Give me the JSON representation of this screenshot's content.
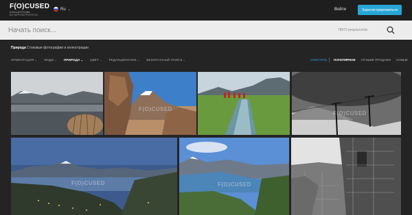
{
  "header": {
    "logo_main": "F(O)CUSED",
    "logo_sub": "COLLECTION",
    "logo_by": "BY DEPOSITPHOTOS",
    "lang": "Ru",
    "login": "Войти",
    "register": "Зарегистрироваться"
  },
  "search": {
    "placeholder": "Начать поиск...",
    "results": "76672 результатов"
  },
  "breadcrumb": {
    "category": "Природа",
    "description": "Стоковые фотографии и иллюстрации"
  },
  "filters": [
    "ОРИЕНТАЦИЯ",
    "ЛЮДИ",
    "ПРИРОДА",
    "ЦВЕТ",
    "РЕДАКЦИОННОЕ",
    "БЕЗОПАСНЫЙ ПОИСК"
  ],
  "filters_active": "ПРИРОДА",
  "clear": "ОЧИСТИТЬ",
  "sorts": [
    "ПОПУЛЯРНОЕ",
    "ЛУЧШИЕ ПРОДАЖИ",
    "НОВЫЕ"
  ],
  "watermark": "F(O)CUSED"
}
